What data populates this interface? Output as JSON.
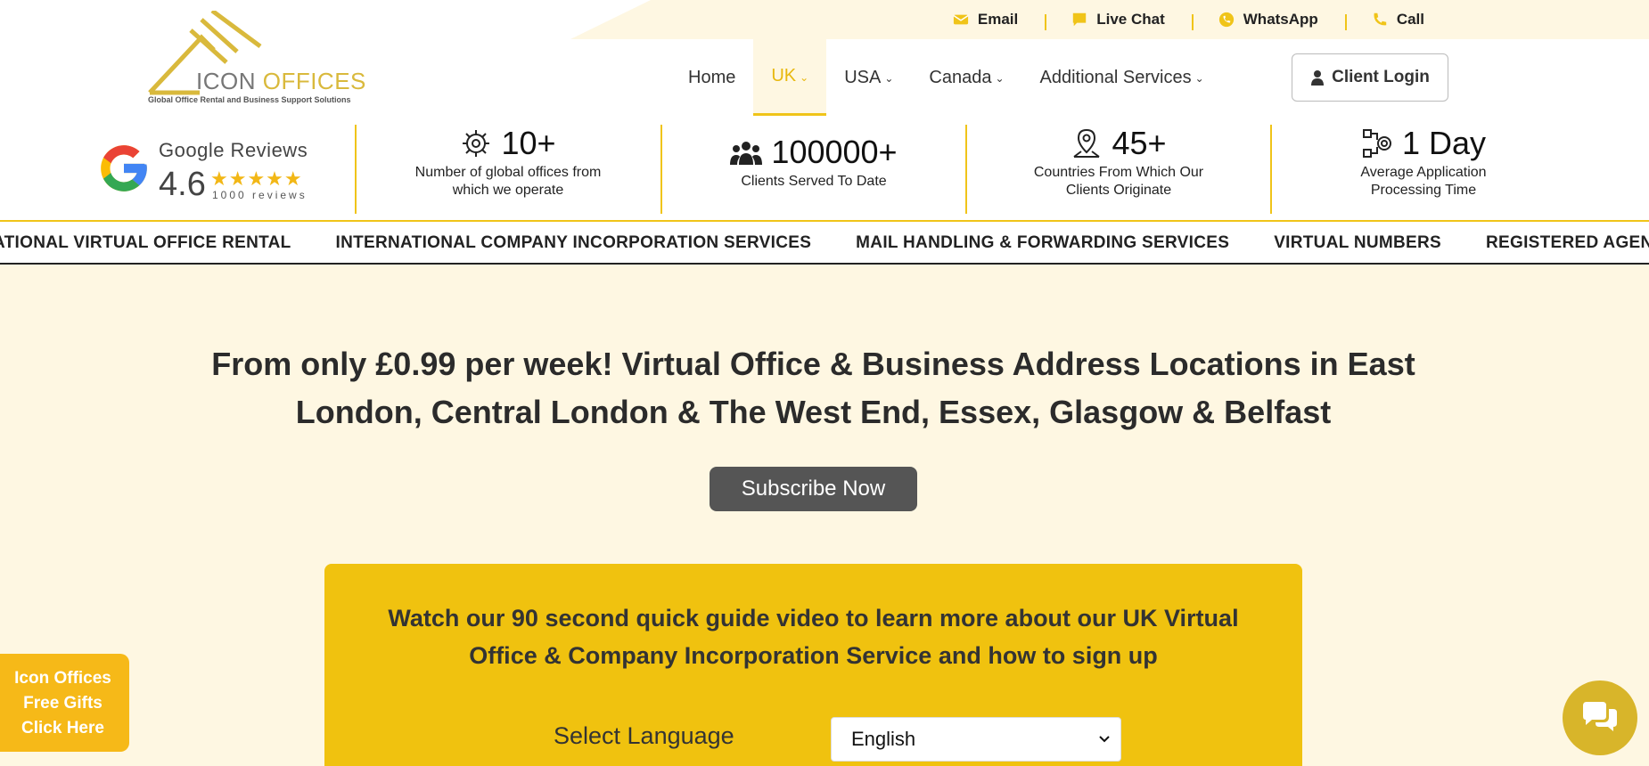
{
  "topbar": {
    "items": [
      {
        "label": "Email",
        "icon": "envelope-icon"
      },
      {
        "label": "Live Chat",
        "icon": "chat-bubble-icon"
      },
      {
        "label": "WhatsApp",
        "icon": "whatsapp-icon"
      },
      {
        "label": "Call",
        "icon": "phone-icon"
      }
    ]
  },
  "logo": {
    "name_part1": "ICON",
    "name_part2": " OFFICES",
    "tagline": "Global Office Rental and Business Support Solutions"
  },
  "nav": {
    "items": [
      {
        "label": "Home"
      },
      {
        "label": "UK",
        "active": true
      },
      {
        "label": "USA"
      },
      {
        "label": "Canada"
      },
      {
        "label": "Additional Services"
      }
    ],
    "login_label": "Client Login"
  },
  "google": {
    "title": "Google Reviews",
    "score": "4.6",
    "stars": "★★★★★",
    "count": "1000 reviews"
  },
  "stats": [
    {
      "number": "10+",
      "label_line1": "Number of global offices from",
      "label_line2": "which we operate",
      "icon": "gear-office-icon"
    },
    {
      "number": "100000+",
      "label_line1": "Clients Served To Date",
      "label_line2": "",
      "icon": "people-group-icon"
    },
    {
      "number": "45+",
      "label_line1": "Countries From Which Our",
      "label_line2": "Clients Originate",
      "icon": "map-pin-icon"
    },
    {
      "number": "1 Day",
      "label_line1": "Average Application",
      "label_line2": "Processing Time",
      "icon": "process-icon"
    }
  ],
  "marquee": {
    "items": [
      "NATIONAL VIRTUAL OFFICE RENTAL",
      "INTERNATIONAL COMPANY INCORPORATION SERVICES",
      "MAIL HANDLING & FORWARDING SERVICES",
      "VIRTUAL NUMBERS",
      "REGISTERED AGENT"
    ]
  },
  "hero": {
    "title": "From only £0.99 per week! Virtual Office & Business Address Locations in East London, Central London & The West End, Essex, Glasgow & Belfast",
    "subscribe_label": "Subscribe Now"
  },
  "video": {
    "title": "Watch our 90 second quick guide video to learn more about our UK Virtual Office & Company Incorporation Service and how to sign up",
    "language_label": "Select Language",
    "language_value": "English"
  },
  "gifts": {
    "line1": "Icon Offices",
    "line2": "Free Gifts",
    "line3": "Click Here"
  },
  "colors": {
    "accent": "#f0c419",
    "cream": "#fef7e2",
    "button_gray": "#555555",
    "chat": "#d8b52a"
  }
}
